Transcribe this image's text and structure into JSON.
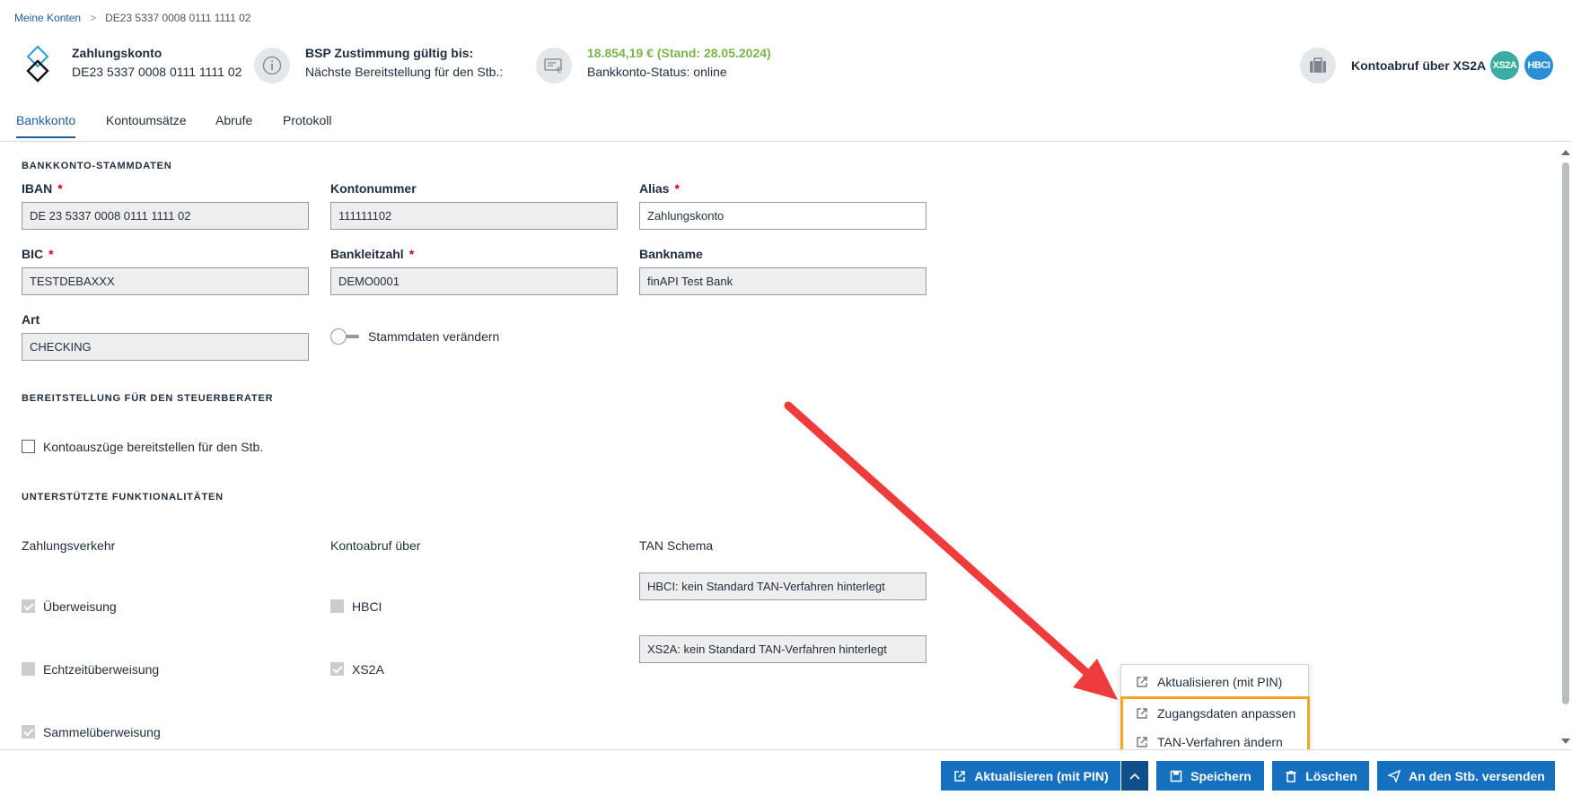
{
  "breadcrumb": {
    "root": "Meine Konten",
    "separator": ">",
    "current": "DE23 5337 0008 0111 1111 02"
  },
  "header": {
    "account_name": "Zahlungskonto",
    "account_iban": "DE23 5337 0008 0111 1111 02",
    "bsp_title": "BSP Zustimmung gültig bis:",
    "bsp_subtitle": "Nächste Bereitstellung für den Stb.:",
    "balance": "18.854,19 € (Stand: 28.05.2024)",
    "status": "Bankkonto-Status: online",
    "retrieval_label": "Kontoabruf über XS2A",
    "badge_xs2a": "XS2A",
    "badge_hbci": "HBCI",
    "badge_xs2a_color": "#3aada0",
    "badge_hbci_color": "#2b8fd6"
  },
  "tabs": [
    {
      "label": "Bankkonto",
      "active": true
    },
    {
      "label": "Kontoumsätze",
      "active": false
    },
    {
      "label": "Abrufe",
      "active": false
    },
    {
      "label": "Protokoll",
      "active": false
    }
  ],
  "stammdaten": {
    "title": "BANKKONTO-STAMMDATEN",
    "iban_label": "IBAN",
    "iban_value": "DE 23 5337 0008 0111 1111 02",
    "kontonummer_label": "Kontonummer",
    "kontonummer_value": "111111102",
    "alias_label": "Alias",
    "alias_value": "Zahlungskonto",
    "bic_label": "BIC",
    "bic_value": "TESTDEBAXXX",
    "blz_label": "Bankleitzahl",
    "blz_value": "DEMO0001",
    "bankname_label": "Bankname",
    "bankname_value": "finAPI Test Bank",
    "art_label": "Art",
    "art_value": "CHECKING",
    "toggle_label": "Stammdaten verändern",
    "required_marker": "*"
  },
  "bereitstellung": {
    "title": "BEREITSTELLUNG FÜR DEN STEUERBERATER",
    "checkbox_label": "Kontoauszüge bereitstellen für den Stb."
  },
  "funktionen": {
    "title": "UNTERSTÜTZTE FUNKTIONALITÄTEN",
    "col1_title": "Zahlungsverkehr",
    "col2_title": "Kontoabruf über",
    "col3_title": "TAN Schema",
    "ueberweisung": "Überweisung",
    "echtzeit": "Echtzeitüberweisung",
    "sammel": "Sammelüberweisung",
    "hbci": "HBCI",
    "xs2a": "XS2A",
    "tan_hbci": "HBCI: kein Standard TAN-Verfahren hinterlegt",
    "tan_xs2a": "XS2A: kein Standard TAN-Verfahren hinterlegt"
  },
  "dropdown": {
    "items": [
      "Aktualisieren (mit PIN)",
      "Zugangsdaten anpassen",
      "TAN-Verfahren ändern"
    ]
  },
  "footer": {
    "refresh_label": "Aktualisieren (mit PIN)",
    "save_label": "Speichern",
    "delete_label": "Löschen",
    "send_label": "An den Stb. versenden"
  },
  "colors": {
    "primary": "#1570c0",
    "primary_dark": "#0f4f8a",
    "balance_green": "#7ab648",
    "highlight_orange": "#f5a623",
    "annotation_red": "#ee3b3b"
  }
}
